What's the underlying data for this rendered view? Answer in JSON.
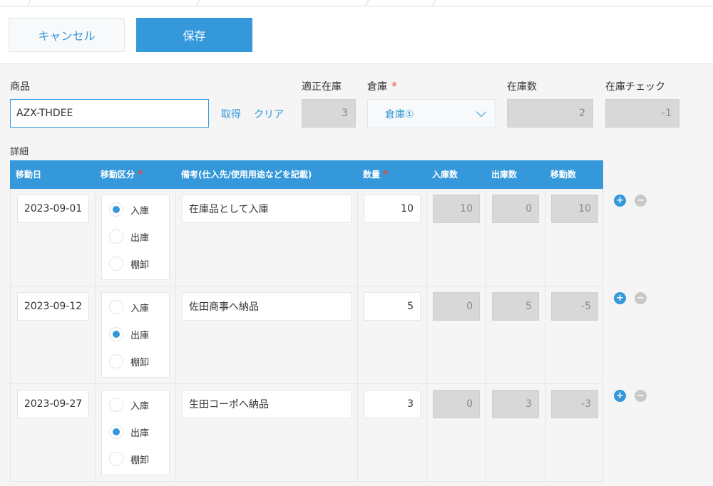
{
  "toolbar": {
    "cancel_label": "キャンセル",
    "save_label": "保存"
  },
  "form": {
    "product": {
      "label": "商品",
      "value": "AZX-THDEE",
      "fetch_label": "取得",
      "clear_label": "クリア"
    },
    "proper_stock": {
      "label": "適正在庫",
      "value": "3"
    },
    "warehouse": {
      "label": "倉庫",
      "value": "倉庫①"
    },
    "stock_count": {
      "label": "在庫数",
      "value": "2"
    },
    "stock_check": {
      "label": "在庫チェック",
      "value": "-1"
    },
    "required_mark": "*"
  },
  "details": {
    "label": "詳細",
    "columns": [
      "移動日",
      "移動区分",
      "備考(仕入先/使用用途などを記載)",
      "数量",
      "入庫数",
      "出庫数",
      "移動数"
    ],
    "radio_options": [
      "入庫",
      "出庫",
      "棚卸"
    ],
    "rows": [
      {
        "date": "2023-09-01",
        "selected": 0,
        "note": "在庫品として入庫",
        "qty": "10",
        "in": "10",
        "out": "0",
        "move": "10"
      },
      {
        "date": "2023-09-12",
        "selected": 1,
        "note": "佐田商事へ納品",
        "qty": "5",
        "in": "0",
        "out": "5",
        "move": "-5"
      },
      {
        "date": "2023-09-27",
        "selected": 1,
        "note": "生田コーポへ納品",
        "qty": "3",
        "in": "0",
        "out": "3",
        "move": "-3"
      }
    ],
    "add_symbol": "+",
    "remove_symbol": "−"
  }
}
